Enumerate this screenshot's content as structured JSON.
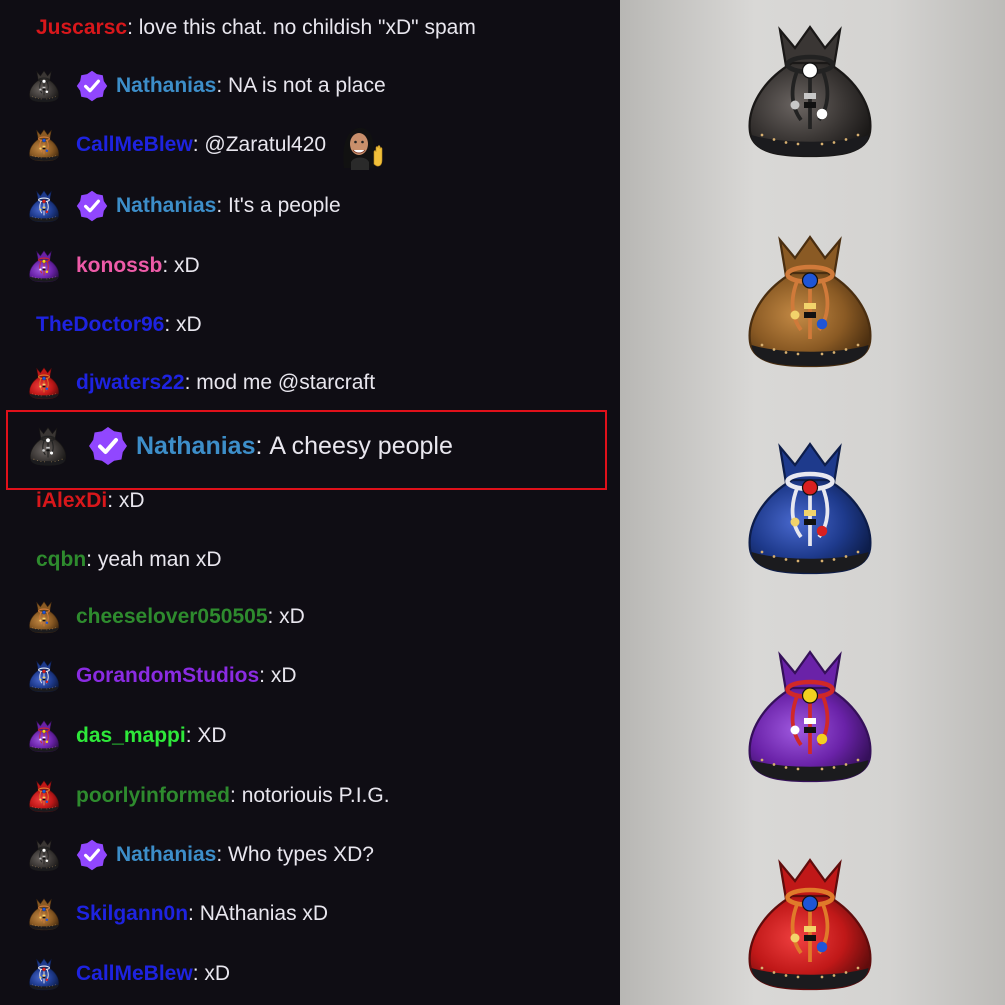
{
  "messages": [
    {
      "badge": "none",
      "verified": false,
      "user": "Juscarsc",
      "color": "#d8171b",
      "text": "love this chat. no childish \"xD\" spam"
    },
    {
      "badge": "black",
      "verified": true,
      "user": "Nathanias",
      "color": "#3d8ec9",
      "text": "NA is not a place"
    },
    {
      "badge": "brown",
      "verified": false,
      "user": "CallMeBlew",
      "color": "#1e23e0",
      "text": "@Zaratul420",
      "emote": "waving-woman"
    },
    {
      "badge": "blue",
      "verified": true,
      "user": "Nathanias",
      "color": "#3d8ec9",
      "text": "It's a people"
    },
    {
      "badge": "purple",
      "verified": false,
      "user": "konossb",
      "color": "#ee5ba8",
      "text": "xD"
    },
    {
      "badge": "none",
      "verified": false,
      "user": "TheDoctor96",
      "color": "#1e23e0",
      "text": "xD"
    },
    {
      "badge": "red",
      "verified": false,
      "user": "djwaters22",
      "color": "#1e23e0",
      "text": "mod me @starcraft"
    },
    {
      "badge": "black",
      "verified": true,
      "user": "Nathanias",
      "color": "#3d8ec9",
      "text": "A cheesy people",
      "highlighted": true
    },
    {
      "badge": "none",
      "verified": false,
      "user": "iAlexDi",
      "color": "#d8171b",
      "text": "xD"
    },
    {
      "badge": "none",
      "verified": false,
      "user": "cqbn",
      "color": "#2e8b2e",
      "text": "yeah man xD"
    },
    {
      "badge": "brown",
      "verified": false,
      "user": "cheeselover050505",
      "color": "#2e8b2e",
      "text": "xD"
    },
    {
      "badge": "blue",
      "verified": false,
      "user": "GorandomStudios",
      "color": "#8a2be2",
      "text": "xD"
    },
    {
      "badge": "purple",
      "verified": false,
      "user": "das_mappi",
      "color": "#2ee83a",
      "text": "XD"
    },
    {
      "badge": "red",
      "verified": false,
      "user": "poorlyinformed",
      "color": "#2e8b2e",
      "text": "notoriouis P.I.G."
    },
    {
      "badge": "black",
      "verified": true,
      "user": "Nathanias",
      "color": "#3d8ec9",
      "text": "Who types XD?"
    },
    {
      "badge": "brown",
      "verified": false,
      "user": "Skilgann0n",
      "color": "#1e23e0",
      "text": "NAthanias xD"
    },
    {
      "badge": "blue",
      "verified": false,
      "user": "CallMeBlew",
      "color": "#1e23e0",
      "text": "xD"
    }
  ],
  "showcase": [
    "black",
    "brown",
    "blue",
    "purple",
    "red"
  ],
  "bag_colors": {
    "black": {
      "main": "#3a3634",
      "light": "#6b6562",
      "dark": "#1a1817",
      "cord": "#222",
      "bead1": "#ffffff",
      "bead2": "#c8c8c8"
    },
    "brown": {
      "main": "#8a5a24",
      "light": "#c48a45",
      "dark": "#4a2e10",
      "cord": "#d07a3a",
      "bead1": "#1f55d6",
      "bead2": "#f2d36b"
    },
    "blue": {
      "main": "#1e3a8c",
      "light": "#4a6ad0",
      "dark": "#0d1d4a",
      "cord": "#e8e8f0",
      "bead1": "#d82020",
      "bead2": "#f2d36b"
    },
    "purple": {
      "main": "#6a22a8",
      "light": "#a05ae0",
      "dark": "#35105a",
      "cord": "#d02828",
      "bead1": "#f2d020",
      "bead2": "#ffffff"
    },
    "red": {
      "main": "#c01818",
      "light": "#f04040",
      "dark": "#600c0c",
      "cord": "#e07a2a",
      "bead1": "#1f55d6",
      "bead2": "#f2d36b"
    }
  },
  "verified_color": "#9147ff",
  "highlight_color": "#e0101a"
}
